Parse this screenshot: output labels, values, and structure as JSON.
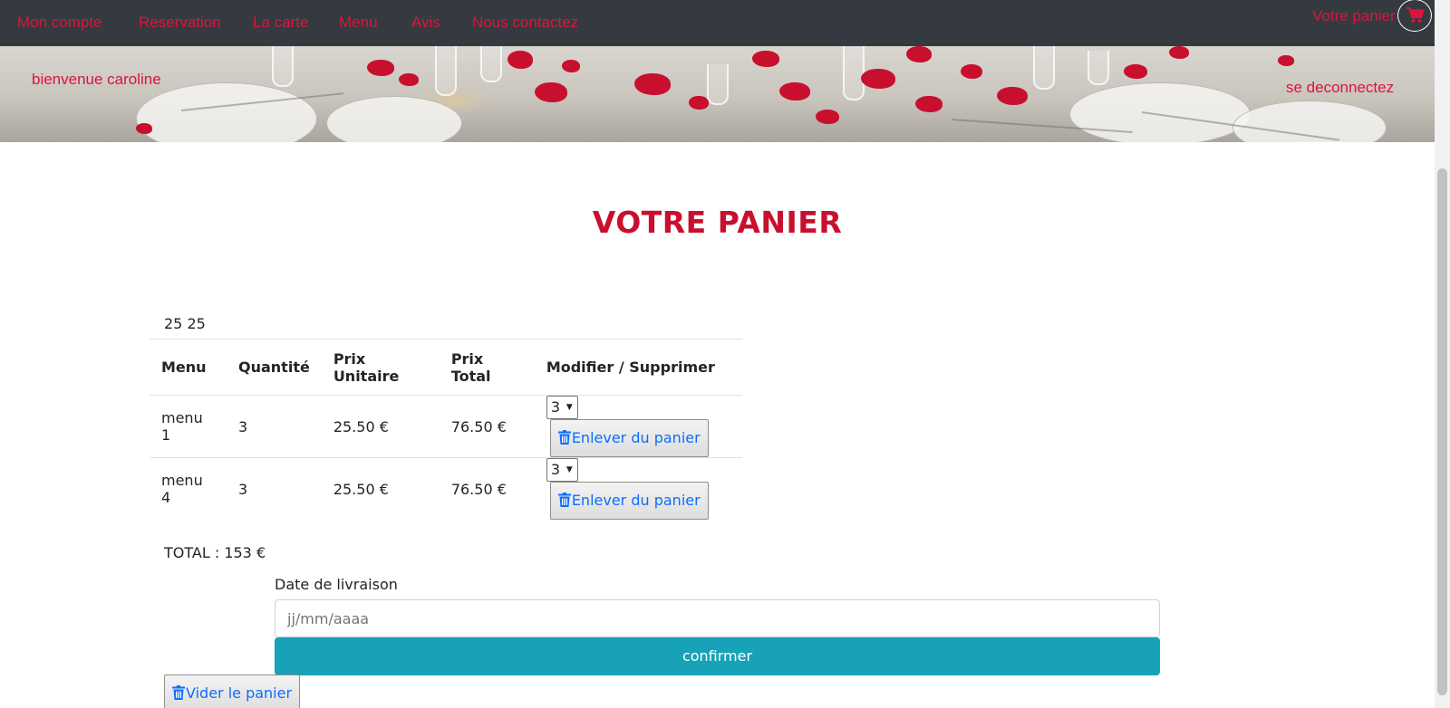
{
  "nav": {
    "items": [
      "Mon compte",
      "Reservation",
      "La carte",
      "Menu",
      "Avis",
      "Nous contactez"
    ],
    "cart_label": "Votre panier",
    "accent_color": "#dc143c",
    "bar_color": "#343a40"
  },
  "banner": {
    "welcome": "bienvenue caroline",
    "logout": "se deconnectez"
  },
  "page": {
    "title": "VOTRE PANIER",
    "info_text": "25 25"
  },
  "table": {
    "headers": [
      "Menu",
      "Quantité",
      "Prix Unitaire",
      "Prix Total",
      "Modifier / Supprimer"
    ],
    "rows": [
      {
        "menu": "menu 1",
        "qty": "3",
        "unit": "25.50 €",
        "total": "76.50 €",
        "select": "3",
        "remove_label": "Enlever du panier"
      },
      {
        "menu": "menu 4",
        "qty": "3",
        "unit": "25.50 €",
        "total": "76.50 €",
        "select": "3",
        "remove_label": "Enlever du panier"
      }
    ]
  },
  "summary": {
    "total": "TOTAL : 153 €"
  },
  "delivery": {
    "label": "Date de livraison",
    "placeholder": "jj/mm/aaaa",
    "confirm_label": "confirmer",
    "confirm_color": "#17a2b8"
  },
  "clear_label": "Vider le panier",
  "icons": {
    "cart": "shopping-cart-icon",
    "trash": "trash-icon"
  }
}
